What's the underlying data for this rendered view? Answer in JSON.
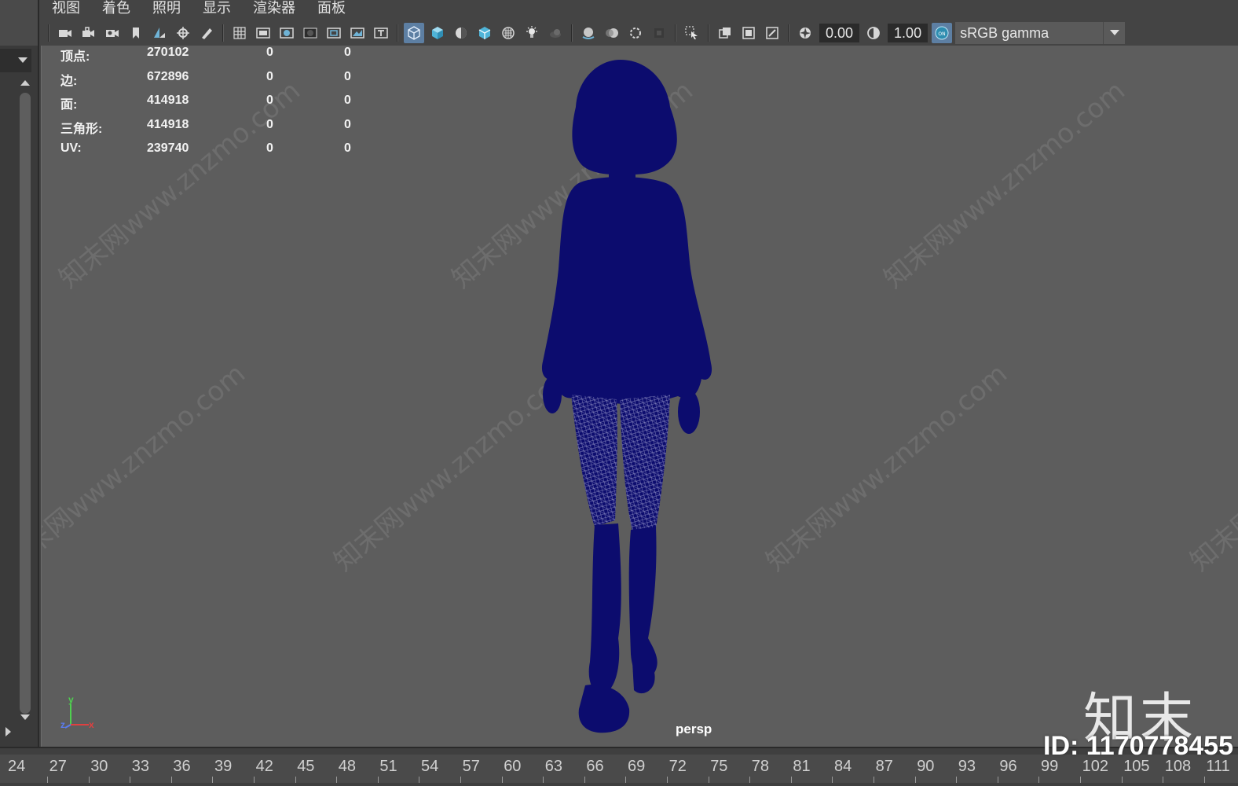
{
  "menu": [
    "视图",
    "着色",
    "照明",
    "显示",
    "渲染器",
    "面板"
  ],
  "toolbar": {
    "exposure_value": "0.00",
    "gamma_value": "1.00",
    "color_space": "sRGB gamma",
    "color_mgmt_toggle": "ON"
  },
  "hud": [
    {
      "label": "顶点:",
      "v1": "270102",
      "v2": "0",
      "v3": "0"
    },
    {
      "label": "边:",
      "v1": "672896",
      "v2": "0",
      "v3": "0"
    },
    {
      "label": "面:",
      "v1": "414918",
      "v2": "0",
      "v3": "0"
    },
    {
      "label": "三角形:",
      "v1": "414918",
      "v2": "0",
      "v3": "0"
    },
    {
      "label": "UV:",
      "v1": "239740",
      "v2": "0",
      "v3": "0"
    }
  ],
  "camera_label": "persp",
  "axis": {
    "x": "x",
    "y": "y",
    "z": "z"
  },
  "watermark_text": "知末网www.znzmo.com",
  "brand_logo": "知末",
  "asset_id": "ID: 1170778455",
  "timeline_ticks": [
    "24",
    "27",
    "30",
    "33",
    "36",
    "39",
    "42",
    "45",
    "48",
    "51",
    "54",
    "57",
    "60",
    "63",
    "66",
    "69",
    "72",
    "75",
    "78",
    "81",
    "84",
    "87",
    "90",
    "93",
    "96",
    "99",
    "102",
    "105",
    "108",
    "111"
  ],
  "colors": {
    "mesh": "#0c0c6e",
    "viewport_bg": "#5d5d5d",
    "active_button": "#5d7fa3"
  }
}
